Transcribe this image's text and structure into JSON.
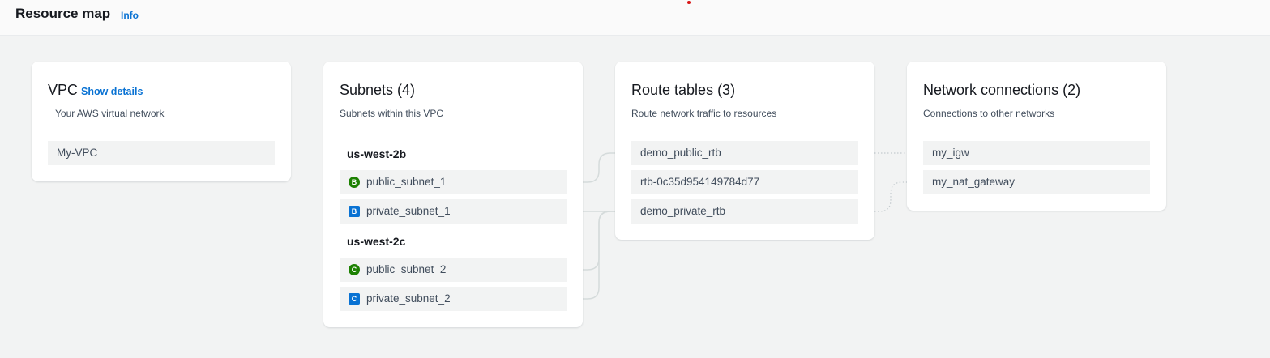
{
  "header": {
    "title": "Resource map",
    "info_label": "Info"
  },
  "vpc": {
    "title": "VPC",
    "show_details_label": "Show details",
    "description": "Your AWS virtual network",
    "name": "My-VPC"
  },
  "subnets": {
    "title": "Subnets (4)",
    "description": "Subnets within this VPC",
    "zones": [
      {
        "name": "us-west-2b",
        "items": [
          {
            "badge": "B",
            "label": "public_subnet_1",
            "type": "public"
          },
          {
            "badge": "B",
            "label": "private_subnet_1",
            "type": "private"
          }
        ]
      },
      {
        "name": "us-west-2c",
        "items": [
          {
            "badge": "C",
            "label": "public_subnet_2",
            "type": "public"
          },
          {
            "badge": "C",
            "label": "private_subnet_2",
            "type": "private"
          }
        ]
      }
    ]
  },
  "route_tables": {
    "title": "Route tables (3)",
    "description": "Route network traffic to resources",
    "items": [
      "demo_public_rtb",
      "rtb-0c35d954149784d77",
      "demo_private_rtb"
    ]
  },
  "network_connections": {
    "title": "Network connections (2)",
    "description": "Connections to other networks",
    "items": [
      "my_igw",
      "my_nat_gateway"
    ]
  },
  "colors": {
    "link": "#0972d3",
    "public_badge": "#1d8102",
    "private_badge": "#0972d3",
    "connector": "#d5dbdb"
  },
  "icons": {
    "public_subnet": "green-circle-badge-icon",
    "private_subnet": "blue-square-badge-icon"
  }
}
